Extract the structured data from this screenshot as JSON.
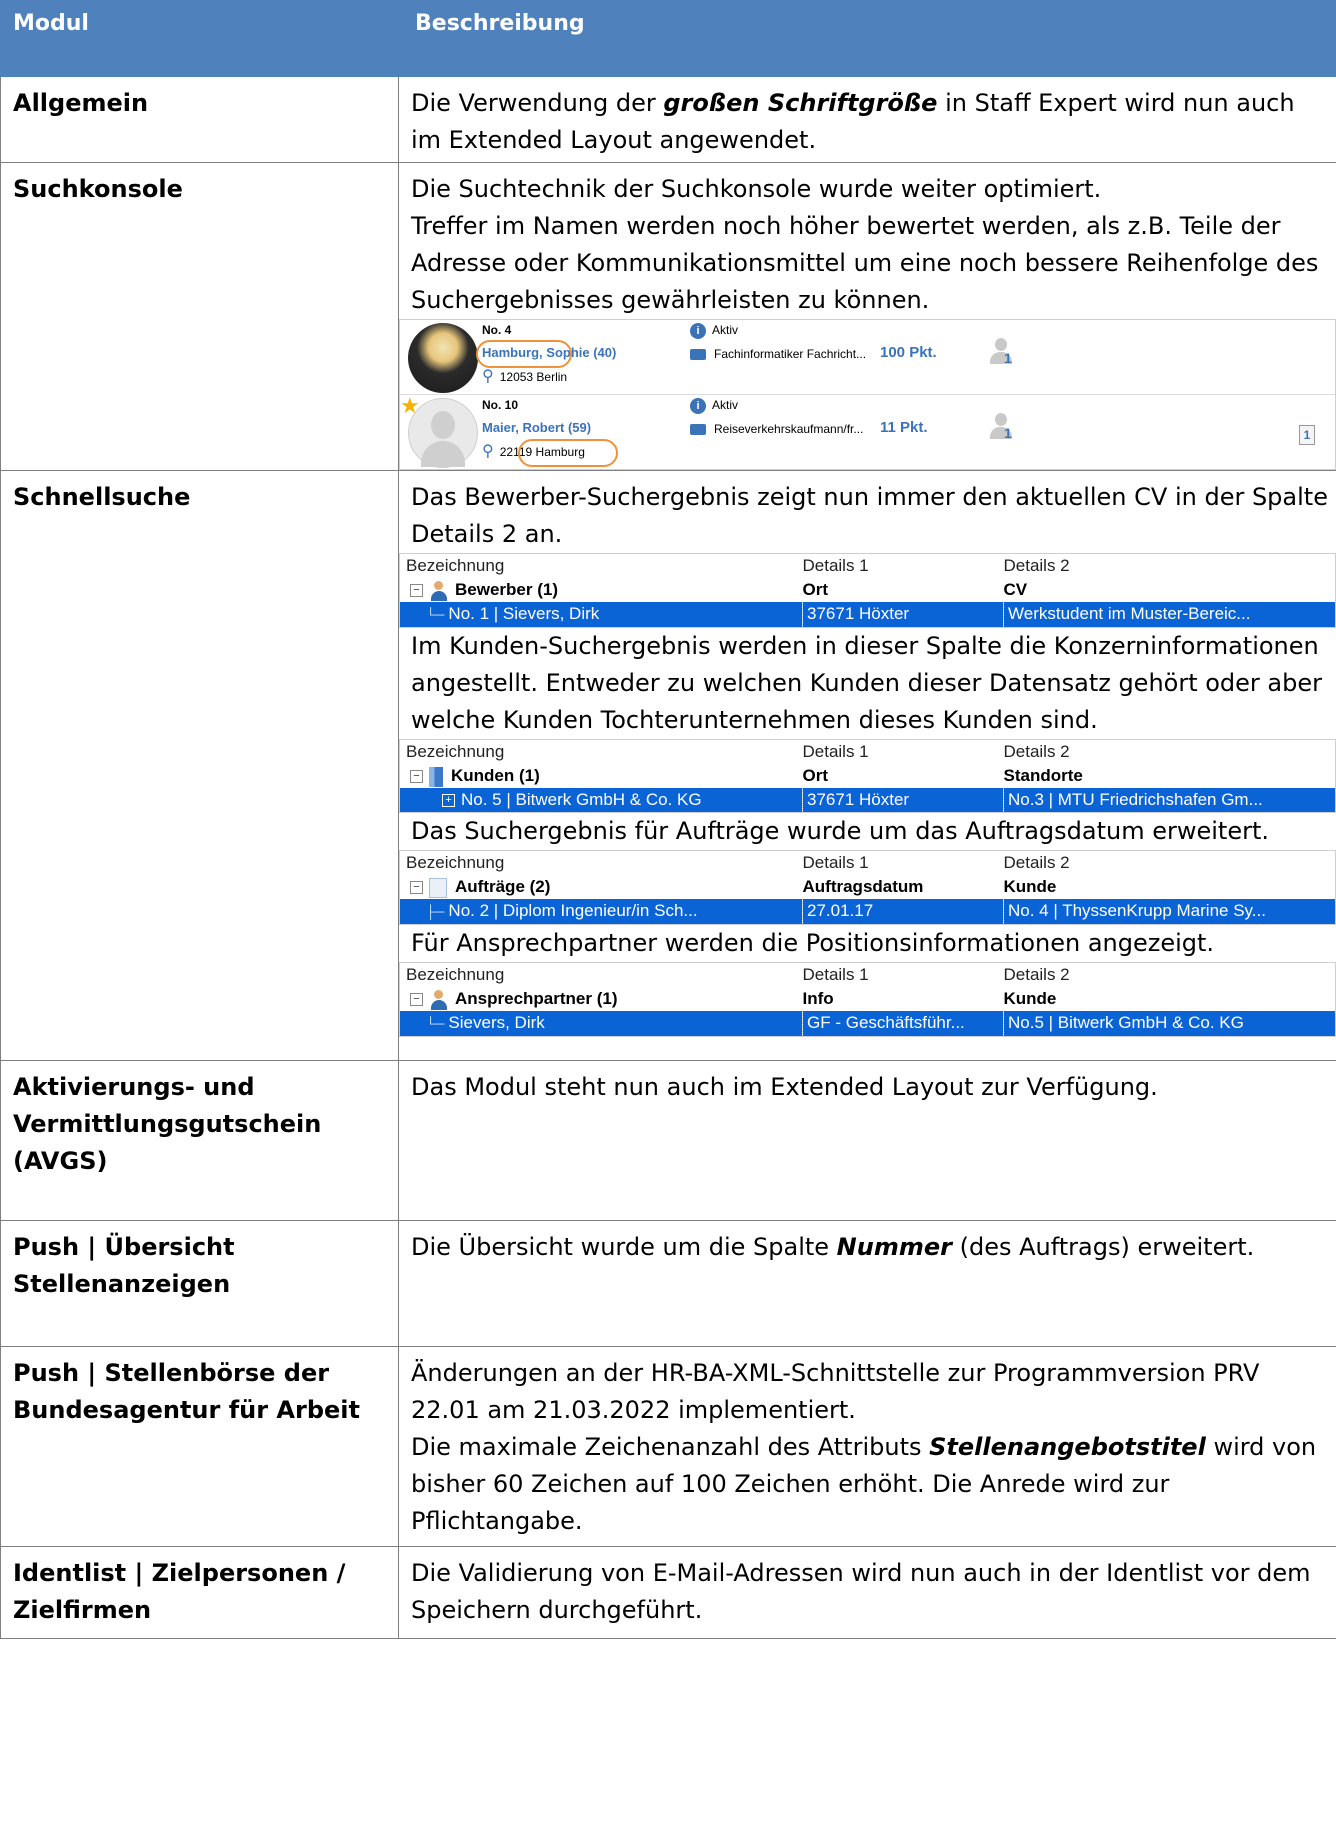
{
  "header": {
    "col_module": "Modul",
    "col_description": "Beschreibung"
  },
  "rows": [
    {
      "module": "Allgemein",
      "desc_parts": [
        "Die Verwendung der ",
        "großen Schriftgröße",
        " in Staff Expert wird nun auch im Extended Layout angewendet."
      ]
    },
    {
      "module": "Suchkonsole",
      "lines": [
        "Die Suchtechnik der Suchkonsole wurde weiter optimiert.",
        "Treffer im Namen werden noch höher bewertet werden, als z.B. Teile der Adresse oder Kommunikationsmittel um eine noch bessere Reihenfolge des Suchergebnisses gewährleisten zu können."
      ],
      "cards": [
        {
          "no": "No. 4",
          "name": "Hamburg, Sophie (40)",
          "location": "12053 Berlin",
          "status": "Aktiv",
          "job": "Fachinformatiker Fachricht...",
          "points": "100 Pkt.",
          "count": "1"
        },
        {
          "no": "No. 10",
          "name": "Maier, Robert (59)",
          "location": "22119 Hamburg",
          "status": "Aktiv",
          "job": "Reiseverkehrskaufmann/fr...",
          "points": "11 Pkt.",
          "count": "1",
          "doc": "1"
        }
      ]
    },
    {
      "module": "Schnellsuche",
      "p1": "Das Bewerber-Suchergebnis zeigt nun immer den aktuellen CV in der Spalte Details 2 an.",
      "p2": "Im Kunden-Suchergebnis werden in dieser Spalte die Konzerninformationen angestellt. Entweder zu welchen Kunden dieser Datensatz gehört oder aber welche Kunden Tochterunternehmen dieses Kunden sind.",
      "p3": "Das Suchergebnis für Aufträge wurde um das Auftragsdatum erweitert.",
      "p4": "Für Ansprechpartner werden die Positionsinformationen angezeigt.",
      "grid_headers": [
        "Bezeichnung",
        "Details 1",
        "Details 2"
      ],
      "grids": [
        {
          "group": [
            "Bewerber (1)",
            "Ort",
            "CV"
          ],
          "row": [
            "No. 1 | Sievers, Dirk",
            "37671 Höxter",
            "Werkstudent im Muster-Bereic..."
          ]
        },
        {
          "group": [
            "Kunden (1)",
            "Ort",
            "Standorte"
          ],
          "row": [
            "No. 5 | Bitwerk GmbH & Co. KG",
            "37671 Höxter",
            "No.3 | MTU Friedrichshafen Gm..."
          ]
        },
        {
          "group": [
            "Aufträge (2)",
            "Auftragsdatum",
            "Kunde"
          ],
          "row": [
            "No. 2 | Diplom Ingenieur/in Sch...",
            "27.01.17",
            "No. 4 | ThyssenKrupp Marine Sy..."
          ]
        },
        {
          "group": [
            "Ansprechpartner (1)",
            "Info",
            "Kunde"
          ],
          "row": [
            "Sievers, Dirk",
            "GF - Geschäftsführ...",
            "No.5 | Bitwerk GmbH & Co. KG"
          ]
        }
      ]
    },
    {
      "module": "Aktivierungs- und Vermittlungsgutschein (AVGS)",
      "desc": "Das Modul steht nun auch im Extended Layout zur Verfügung."
    },
    {
      "module": "Push | Übersicht Stellenanzeigen",
      "desc_parts": [
        "Die Übersicht wurde um die Spalte ",
        "Nummer",
        " (des Auftrags) erweitert."
      ]
    },
    {
      "module": "Push | Stellenbörse der Bundesagentur für Arbeit",
      "line1": "Änderungen an der HR-BA-XML-Schnittstelle zur Programmversion PRV 22.01 am 21.03.2022 implementiert.",
      "desc_parts": [
        "Die maximale Zeichenanzahl des Attributs ",
        "Stellenangebotstitel",
        " wird von bisher 60 Zeichen auf 100 Zeichen erhöht. Die Anrede wird zur Pflichtangabe."
      ]
    },
    {
      "module": "Identlist | Zielpersonen / Zielfirmen",
      "desc": "Die Validierung von E-Mail-Adressen wird nun auch in der Identlist vor dem Speichern durchgeführt."
    }
  ]
}
